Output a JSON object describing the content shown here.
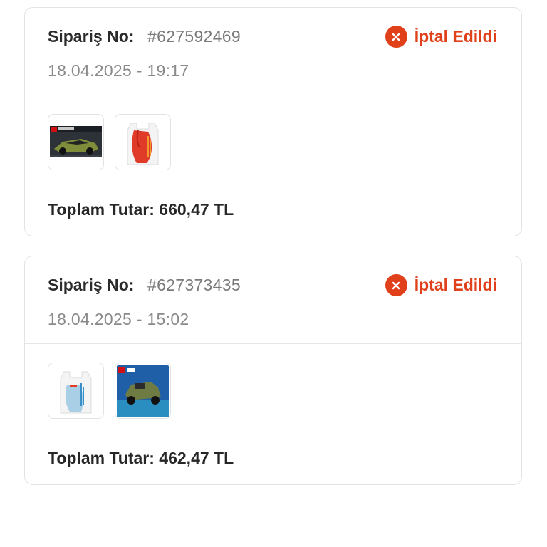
{
  "orders": [
    {
      "order_label": "Sipariş No:",
      "order_number": "#627592469",
      "date": "18.04.2025 - 19:17",
      "status": "İptal Edildi",
      "status_color": "#e0411b",
      "items": [
        {
          "icon": "lego-speed-champions-box"
        },
        {
          "icon": "migros-shopping-bag-red"
        }
      ],
      "total": "Toplam Tutar: 660,47 TL"
    },
    {
      "order_label": "Sipariş No:",
      "order_number": "#627373435",
      "date": "18.04.2025 - 15:02",
      "status": "İptal Edildi",
      "status_color": "#e0411b",
      "items": [
        {
          "icon": "migros-shopping-bag-blue"
        },
        {
          "icon": "lego-city-box"
        }
      ],
      "total": "Toplam Tutar: 462,47 TL"
    }
  ]
}
